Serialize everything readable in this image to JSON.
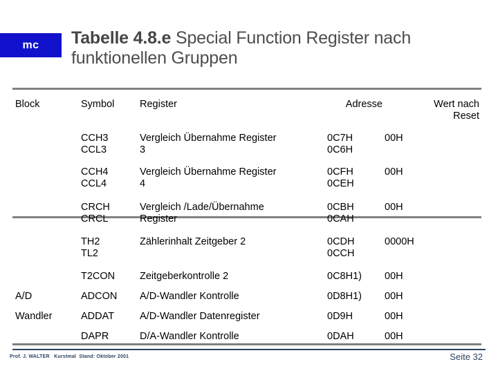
{
  "header": {
    "logo": "mc",
    "title_strong": "Tabelle 4.8.e",
    "title_rest": " Special Function Register nach\nfunktionellen Gruppen"
  },
  "table": {
    "columns": {
      "block": "Block",
      "symbol": "Symbol",
      "register": "Register",
      "address": "Adresse",
      "value": "Wert nach\nReset"
    },
    "rows": [
      {
        "block": "",
        "symbol": "CCH3\nCCL3",
        "register": "Vergleich Übernahme Register\n   3",
        "address": "0C7H\n0C6H",
        "value": "00H"
      },
      {
        "block": "",
        "symbol": "CCH4\nCCL4",
        "register": "Vergleich Übernahme Register\n   4",
        "address": "0CFH\n0CEH",
        "value": "00H"
      },
      {
        "block": "",
        "symbol": "CRCH\nCRCL",
        "register": "Vergleich /Lade/Übernahme\n  Register",
        "address": "0CBH\n0CAH",
        "value": "00H"
      },
      {
        "block": "",
        "symbol": "TH2\nTL2",
        "register": "Zählerinhalt Zeitgeber 2",
        "address": "0CDH\n0CCH",
        "value": "0000H"
      },
      {
        "block": "",
        "symbol": "T2CON",
        "register": "Zeitgeberkontrolle 2",
        "address": "0C8H1)",
        "value": "00H"
      },
      {
        "block": "A/D",
        "symbol": "ADCON",
        "register": "A/D-Wandler Kontrolle",
        "address": "0D8H1)",
        "value": "00H"
      },
      {
        "block": "Wandler",
        "symbol": "ADDAT",
        "register": "A/D-Wandler Datenregister",
        "address": "0D9H",
        "value": "00H"
      },
      {
        "block": "",
        "symbol": "DAPR",
        "register": "D/A-Wandler Kontrolle",
        "address": "0DAH",
        "value": "00H"
      }
    ]
  },
  "footer": {
    "credit": "Prof. J. WALTER   Kurstmal  Stand: Oktober 2001",
    "page": "Seite 32"
  },
  "colors": {
    "logo_background": "#1111cc",
    "rule": "#808080",
    "footer_accent": "#2d4361",
    "title_text": "#4d4d4d"
  }
}
